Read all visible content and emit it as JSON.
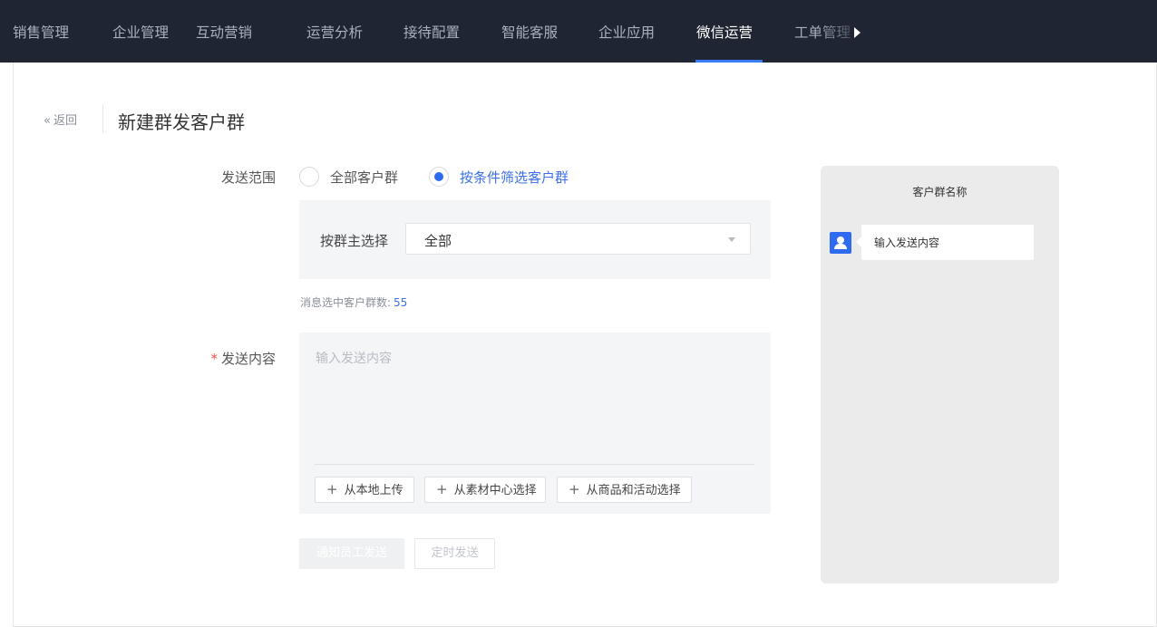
{
  "nav": {
    "items": [
      {
        "label": "销售管理",
        "active": false
      },
      {
        "label": "企业管理",
        "active": false
      },
      {
        "label": "互动营销",
        "active": false
      },
      {
        "label": "运营分析",
        "active": false
      },
      {
        "label": "接待配置",
        "active": false
      },
      {
        "label": "智能客服",
        "active": false
      },
      {
        "label": "企业应用",
        "active": false
      },
      {
        "label": "微信运营",
        "active": true
      },
      {
        "label": "工单管理",
        "active": false
      }
    ],
    "more_icon": "caret-right-icon"
  },
  "header": {
    "back_label": "返回",
    "back_icon": "double-chevron-left-icon",
    "title": "新建群发客户群"
  },
  "form": {
    "scope_label": "发送范围",
    "scope_options": [
      {
        "label": "全部客户群",
        "checked": false
      },
      {
        "label": "按条件筛选客户群",
        "checked": true
      }
    ],
    "owner_label": "按群主选择",
    "owner_value": "全部",
    "count_prefix": "消息选中客户群数:",
    "count_value": "55",
    "content_label": "发送内容",
    "content_placeholder": "输入发送内容",
    "upload_buttons": [
      {
        "label": "从本地上传"
      },
      {
        "label": "从素材中心选择"
      },
      {
        "label": "从商品和活动选择"
      }
    ],
    "notify_button": "通知员工发送",
    "schedule_button": "定时发送"
  },
  "preview": {
    "title": "客户群名称",
    "bubble_text": "输入发送内容"
  },
  "colors": {
    "nav_bg": "#1f2532",
    "accent": "#2f6bf0",
    "required": "#f24b4b"
  }
}
